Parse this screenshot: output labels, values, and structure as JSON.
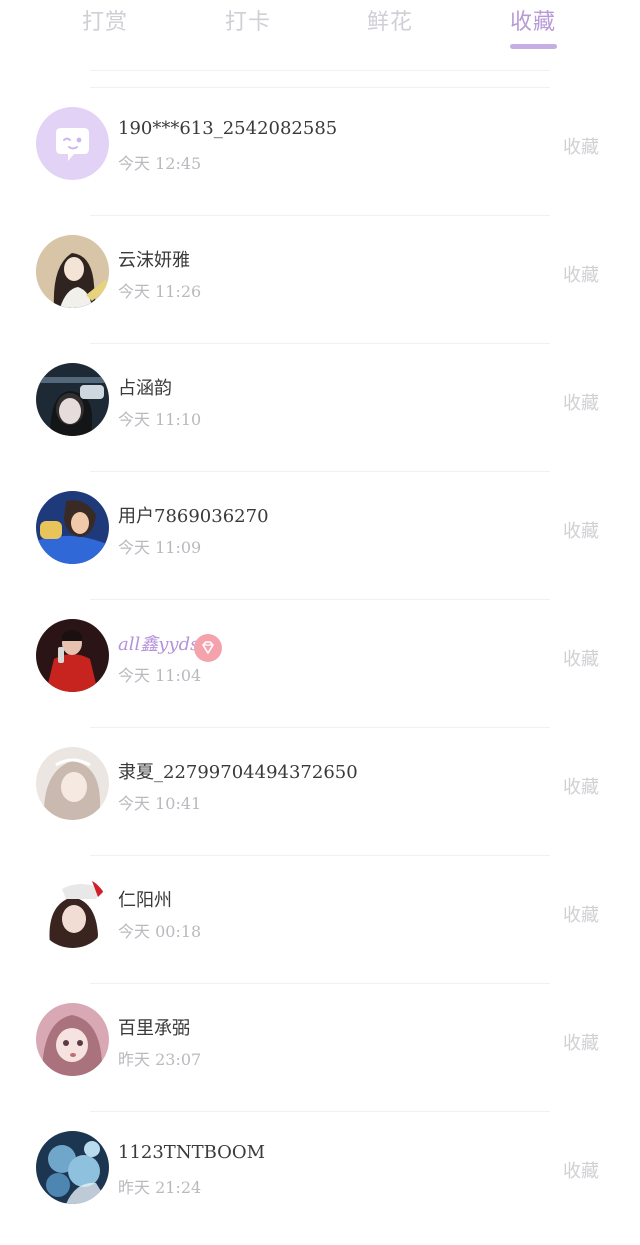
{
  "tabs": [
    {
      "label": "打赏",
      "active": false
    },
    {
      "label": "打卡",
      "active": false
    },
    {
      "label": "鲜花",
      "active": false
    },
    {
      "label": "收藏",
      "active": true
    }
  ],
  "colors": {
    "accent": "#b79ad6",
    "tab_inactive": "#cfcfd6",
    "vip_name": "#b592d9",
    "vip_badge": "#f4a3ad"
  },
  "list": [
    {
      "name": "190***613_2542082585",
      "time": "今天 12:45",
      "action": "收藏",
      "avatar": "default-chat-avatar"
    },
    {
      "name": "云沫妍雅",
      "time": "今天 11:26",
      "action": "收藏",
      "avatar": "user-photo-avatar"
    },
    {
      "name": "占涵韵",
      "time": "今天 11:10",
      "action": "收藏",
      "avatar": "user-photo-avatar"
    },
    {
      "name": "用户7869036270",
      "time": "今天 11:09",
      "action": "收藏",
      "avatar": "user-photo-avatar"
    },
    {
      "name": "all鑫yyds",
      "time": "今天 11:04",
      "action": "收藏",
      "avatar": "user-photo-avatar",
      "vip": true
    },
    {
      "name": "隶夏_22799704494372650",
      "time": "今天 10:41",
      "action": "收藏",
      "avatar": "user-photo-avatar"
    },
    {
      "name": "仁阳州",
      "time": "今天 00:18",
      "action": "收藏",
      "avatar": "user-photo-avatar"
    },
    {
      "name": "百里承弼",
      "time": "昨天 23:07",
      "action": "收藏",
      "avatar": "user-photo-avatar"
    },
    {
      "name": "1123TNTBOOM",
      "time": "昨天 21:24",
      "action": "收藏",
      "avatar": "user-photo-avatar"
    }
  ]
}
